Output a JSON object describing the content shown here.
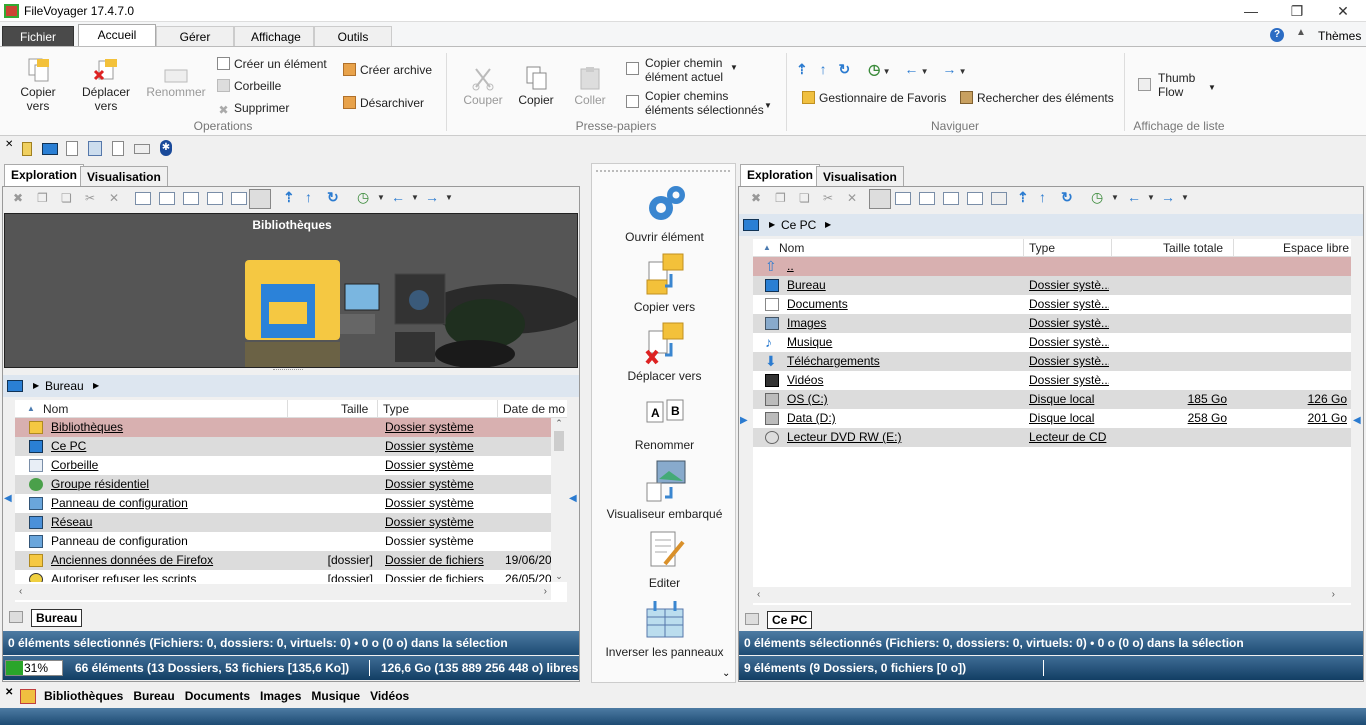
{
  "app": {
    "title": "FileVoyager 17.4.7.0"
  },
  "ribbon_tabs": [
    "Fichier",
    "Accueil",
    "Gérer",
    "Affichage",
    "Outils"
  ],
  "themes": "Thèmes",
  "ribbon": {
    "operations": {
      "label": "Operations",
      "copy_to": [
        "Copier",
        "vers"
      ],
      "move_to": [
        "Déplacer",
        "vers"
      ],
      "rename": "Renommer",
      "create": "Créer un élément",
      "trash": "Corbeille",
      "delete": "Supprimer",
      "create_archive": "Créer archive",
      "unarchive": "Désarchiver"
    },
    "clipboard": {
      "label": "Presse-papiers",
      "cut": "Couper",
      "copy": "Copier",
      "paste": "Coller",
      "copy_path": [
        "Copier chemin",
        "élément actuel"
      ],
      "copy_paths": [
        "Copier chemins",
        "éléments sélectionnés"
      ]
    },
    "navigate": {
      "label": "Naviguer",
      "favorites": "Gestionnaire de Favoris",
      "search": "Rechercher des éléments"
    },
    "listview": {
      "label": "Affichage de liste",
      "thumb": [
        "Thumb",
        "Flow"
      ]
    }
  },
  "left": {
    "tabs": [
      "Exploration",
      "Visualisation"
    ],
    "preview_title": "Bibliothèques",
    "address": "Bureau",
    "columns": [
      "Nom",
      "Taille",
      "Type",
      "Date de mo"
    ],
    "rows": [
      {
        "name": "Bibliothèques",
        "size": "",
        "type": "Dossier système",
        "date": "",
        "style": "pink",
        "u": true,
        "icon": "library"
      },
      {
        "name": "Ce PC",
        "size": "",
        "type": "Dossier système",
        "date": "",
        "style": "gray",
        "u": true,
        "icon": "pc"
      },
      {
        "name": "Corbeille",
        "size": "",
        "type": "Dossier système",
        "date": "",
        "style": "",
        "u": true,
        "icon": "trash"
      },
      {
        "name": "Groupe résidentiel",
        "size": "",
        "type": "Dossier système",
        "date": "",
        "style": "gray",
        "u": true,
        "icon": "group"
      },
      {
        "name": "Panneau de configuration",
        "size": "",
        "type": "Dossier système",
        "date": "",
        "style": "",
        "u": true,
        "icon": "panel"
      },
      {
        "name": "Réseau",
        "size": "",
        "type": "Dossier système",
        "date": "",
        "style": "gray",
        "u": true,
        "icon": "network"
      },
      {
        "name": "Panneau de configuration",
        "size": "",
        "type": "Dossier système",
        "date": "",
        "style": "",
        "u": false,
        "icon": "panel"
      },
      {
        "name": "Anciennes données de Firefox",
        "size": "[dossier]",
        "type": "Dossier de fichiers",
        "date": "19/06/20",
        "style": "gray",
        "u": true,
        "icon": "folder"
      },
      {
        "name": "Autoriser refuser les scripts",
        "size": "[dossier]",
        "type": "Dossier de fichiers",
        "date": "26/05/20",
        "style": "",
        "u": false,
        "icon": "shield"
      }
    ],
    "bottom_tab": "Bureau",
    "status_sel": "0 éléments sélectionnés (Fichiers: 0, dossiers: 0, virtuels: 0) • 0 o (0 o) dans la sélection",
    "progress": "31%",
    "progress_value": 0.31,
    "status_count": "66 éléments (13 Dossiers, 53 fichiers [135,6 Ko])",
    "status_free": "126,6 Go (135 889 256 448 o) libres"
  },
  "center": {
    "commands": [
      "Ouvrir élément",
      "Copier vers",
      "Déplacer vers",
      "Renommer",
      "Visualiseur embarqué",
      "Editer",
      "Inverser les panneaux"
    ]
  },
  "right": {
    "tabs": [
      "Exploration",
      "Visualisation"
    ],
    "address": "Ce PC",
    "columns": [
      "Nom",
      "Type",
      "Taille totale",
      "Espace libre"
    ],
    "rows": [
      {
        "name": "..",
        "type": "",
        "total": "",
        "free": "",
        "style": "pink",
        "icon": "up"
      },
      {
        "name": "Bureau",
        "type": "Dossier systè...",
        "total": "",
        "free": "",
        "style": "gray",
        "icon": "pc"
      },
      {
        "name": "Documents",
        "type": "Dossier systè...",
        "total": "",
        "free": "",
        "style": "",
        "icon": "doc"
      },
      {
        "name": "Images",
        "type": "Dossier systè...",
        "total": "",
        "free": "",
        "style": "gray",
        "icon": "image"
      },
      {
        "name": "Musique",
        "type": "Dossier systè...",
        "total": "",
        "free": "",
        "style": "",
        "icon": "music"
      },
      {
        "name": "Téléchargements",
        "type": "Dossier systè...",
        "total": "",
        "free": "",
        "style": "gray",
        "icon": "download"
      },
      {
        "name": "Vidéos",
        "type": "Dossier systè...",
        "total": "",
        "free": "",
        "style": "",
        "icon": "video"
      },
      {
        "name": "OS (C:)",
        "type": "Disque local",
        "total": "185 Go",
        "free": "126 Go",
        "style": "gray",
        "icon": "drive"
      },
      {
        "name": "Data (D:)",
        "type": "Disque local",
        "total": "258 Go",
        "free": "201 Go",
        "style": "",
        "icon": "drive"
      },
      {
        "name": "Lecteur DVD RW (E:)",
        "type": "Lecteur de CD",
        "total": "",
        "free": "",
        "style": "gray",
        "icon": "dvd"
      }
    ],
    "bottom_tab": "Ce PC",
    "status_sel": "0 éléments sélectionnés (Fichiers: 0, dossiers: 0, virtuels: 0) • 0 o (0 o) dans la sélection",
    "status_count": "9 éléments (9 Dossiers, 0 fichiers [0 o])"
  },
  "favorites": [
    "Bibliothèques",
    "Bureau",
    "Documents",
    "Images",
    "Musique",
    "Vidéos"
  ],
  "colors": {
    "accent": "#2b579a",
    "pink_row": "#d8b0b0",
    "gray_row": "#dcdcdc",
    "status_bar": "#1d4b73"
  }
}
